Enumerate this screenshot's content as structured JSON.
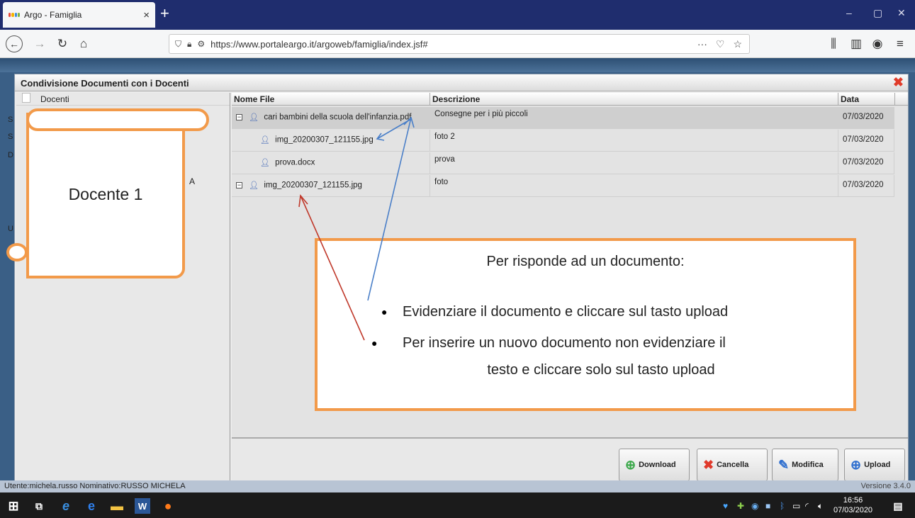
{
  "browser": {
    "tab_title": "Argo - Famiglia",
    "tab_close": "×",
    "new_tab": "+",
    "url": "https://www.portaleargo.it/argoweb/famiglia/index.jsf#",
    "url_more": "···",
    "win_min": "–",
    "win_max": "▢",
    "win_close": "✕"
  },
  "dialog": {
    "title": "Condivisione Documenti con i Docenti",
    "close": "✖"
  },
  "left_panel": {
    "header": "Docenti",
    "fragments": [
      "S",
      "S",
      "D",
      "U"
    ],
    "trailing_letter": "A"
  },
  "annotation_scroll": {
    "text": "Docente 1"
  },
  "table": {
    "columns": [
      "Nome File",
      "Descrizione",
      "Data"
    ],
    "rows": [
      {
        "name": "cari bambini della scuola dell'infanzia.pdf",
        "desc": "Consegne per i più piccoli",
        "date": "07/03/2020",
        "expander": "−"
      },
      {
        "name": "img_20200307_121155.jpg",
        "desc": "foto 2",
        "date": "07/03/2020"
      },
      {
        "name": "prova.docx",
        "desc": "prova",
        "date": "07/03/2020"
      },
      {
        "name": "img_20200307_121155.jpg",
        "desc": "foto",
        "date": "07/03/2020",
        "expander": "−"
      }
    ]
  },
  "buttons": {
    "download": "Download",
    "cancella": "Cancella",
    "modifica": "Modifica",
    "upload": "Upload"
  },
  "callout": {
    "title": "Per risponde ad un documento:",
    "item1": "Evidenziare il documento e cliccare sul tasto upload",
    "item2_line1": "Per inserire un nuovo documento non evidenziare il",
    "item2_line2": "testo e cliccare solo sul tasto upload"
  },
  "status": {
    "user": "Utente:michela.russo Nominativo:RUSSO MICHELA",
    "version": "Versione 3.4.0"
  },
  "taskbar": {
    "time": "16:56",
    "date": "07/03/2020"
  },
  "colors": {
    "accent_orange": "#f29a4a",
    "arrow_blue": "#4a7fc8",
    "arrow_red": "#c0392b"
  }
}
